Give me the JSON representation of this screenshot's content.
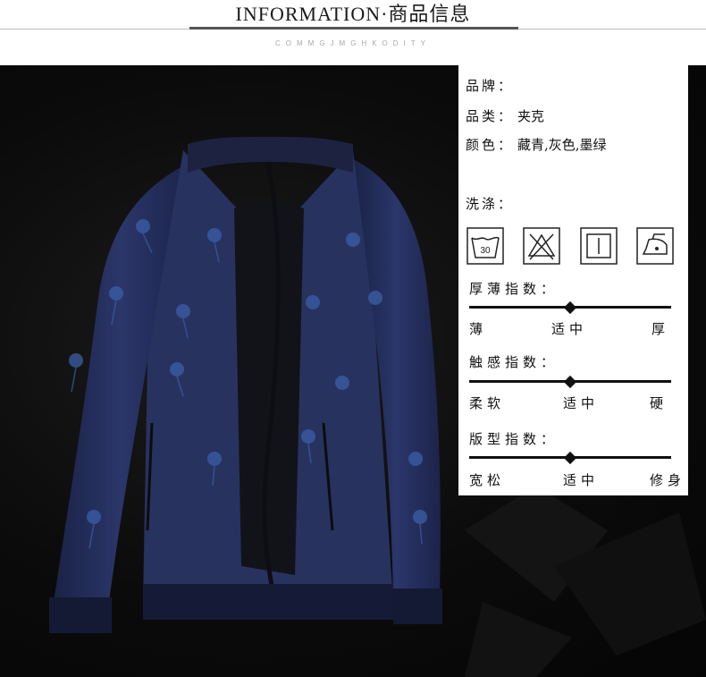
{
  "header": {
    "title": "INFORMATION·商品信息",
    "subtitle": "COMMGJMGHKODITY"
  },
  "info": {
    "brand_label": "品牌：",
    "brand_value": "",
    "category_label": "品类：",
    "category_value": "夹克",
    "color_label": "颜色：",
    "color_value": "藏青,灰色,墨绿",
    "wash_label": "洗涤："
  },
  "care_icons": [
    {
      "name": "wash-30-icon",
      "text": "30"
    },
    {
      "name": "no-bleach-icon"
    },
    {
      "name": "tumble-dry-icon"
    },
    {
      "name": "iron-low-icon"
    }
  ],
  "scales": [
    {
      "title": "厚薄指数：",
      "left": "薄",
      "mid": "适中",
      "right": "厚",
      "level": 0.5
    },
    {
      "title": "触感指数：",
      "left": "柔软",
      "mid": "适中",
      "right": "硬",
      "level": 0.5
    },
    {
      "title": "版型指数：",
      "left": "宽松",
      "mid": "适中",
      "right": "修身",
      "level": 0.5
    }
  ],
  "colors": {
    "jacket": "#25305a",
    "background": "#0b0b0b"
  }
}
